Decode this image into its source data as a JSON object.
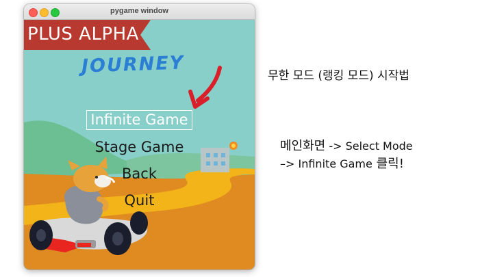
{
  "window": {
    "title": "pygame window"
  },
  "game": {
    "banner": "PLUS ALPHA",
    "logo_title": "JOURNEY",
    "menu": [
      {
        "label": "Infinite Game",
        "selected": true
      },
      {
        "label": "Stage Game",
        "selected": false
      },
      {
        "label": "Back",
        "selected": false
      },
      {
        "label": "Quit",
        "selected": false
      }
    ]
  },
  "annotations": {
    "heading": "무한 모드 (랭킹 모드) 시작법",
    "step_line1_a": "메인화면",
    "step_line1_b": " -> Select Mode",
    "step_line2_a": "–> Infinite Game",
    "step_line2_b": " 클릭!"
  },
  "colors": {
    "sky": "#89cfc9",
    "banner": "#b8392f",
    "ground_orange": "#e08a22",
    "road_yellow": "#f2b418",
    "arrow_red": "#d81f2a",
    "logo_blue": "#2a7fd4"
  }
}
